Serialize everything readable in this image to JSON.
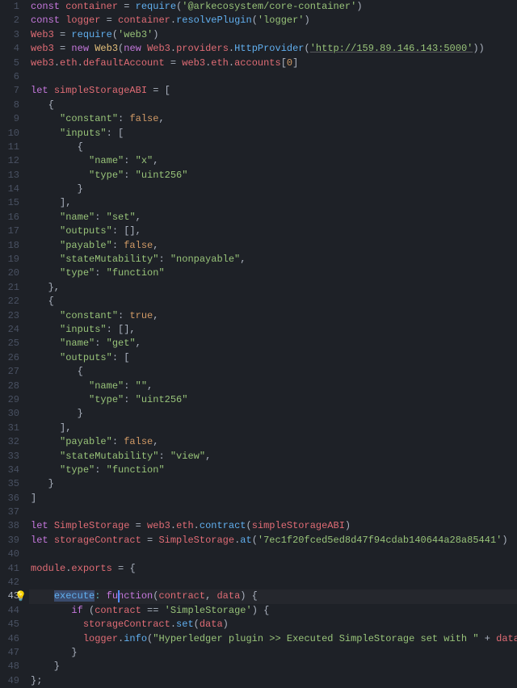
{
  "editor": {
    "current_line": 43,
    "hint_icon": "lightbulb-icon",
    "lines": [
      {
        "n": 1,
        "tokens": [
          [
            "k",
            "const "
          ],
          [
            "v",
            "container"
          ],
          [
            "d",
            " = "
          ],
          [
            "fn",
            "require"
          ],
          [
            "d",
            "("
          ],
          [
            "s",
            "'@arkecosystem/core-container'"
          ],
          [
            "d",
            ")"
          ]
        ]
      },
      {
        "n": 2,
        "tokens": [
          [
            "k",
            "const "
          ],
          [
            "v",
            "logger"
          ],
          [
            "d",
            " = "
          ],
          [
            "v",
            "container"
          ],
          [
            "d",
            "."
          ],
          [
            "fn",
            "resolvePlugin"
          ],
          [
            "d",
            "("
          ],
          [
            "s",
            "'logger'"
          ],
          [
            "d",
            ")"
          ]
        ]
      },
      {
        "n": 3,
        "tokens": [
          [
            "v",
            "Web3"
          ],
          [
            "d",
            " = "
          ],
          [
            "fn",
            "require"
          ],
          [
            "d",
            "("
          ],
          [
            "s",
            "'web3'"
          ],
          [
            "d",
            ")"
          ]
        ]
      },
      {
        "n": 4,
        "tokens": [
          [
            "v",
            "web3"
          ],
          [
            "d",
            " = "
          ],
          [
            "k",
            "new "
          ],
          [
            "p",
            "Web3"
          ],
          [
            "d",
            "("
          ],
          [
            "k",
            "new "
          ],
          [
            "v",
            "Web3"
          ],
          [
            "d",
            "."
          ],
          [
            "v",
            "providers"
          ],
          [
            "d",
            "."
          ],
          [
            "fn",
            "HttpProvider"
          ],
          [
            "d",
            "("
          ],
          [
            "s lnk",
            "'http://159.89.146.143:5000'"
          ],
          [
            "d",
            "))"
          ]
        ]
      },
      {
        "n": 5,
        "tokens": [
          [
            "v",
            "web3"
          ],
          [
            "d",
            "."
          ],
          [
            "v",
            "eth"
          ],
          [
            "d",
            "."
          ],
          [
            "v",
            "defaultAccount"
          ],
          [
            "d",
            " = "
          ],
          [
            "v",
            "web3"
          ],
          [
            "d",
            "."
          ],
          [
            "v",
            "eth"
          ],
          [
            "d",
            "."
          ],
          [
            "v",
            "accounts"
          ],
          [
            "d",
            "["
          ],
          [
            "n",
            "0"
          ],
          [
            "d",
            "]"
          ]
        ]
      },
      {
        "n": 6,
        "tokens": []
      },
      {
        "n": 7,
        "tokens": [
          [
            "k",
            "let "
          ],
          [
            "v",
            "simpleStorageABI"
          ],
          [
            "d",
            " = ["
          ]
        ]
      },
      {
        "n": 8,
        "tokens": [
          [
            "d",
            "   {"
          ]
        ]
      },
      {
        "n": 9,
        "tokens": [
          [
            "d",
            "     "
          ],
          [
            "s",
            "\"constant\""
          ],
          [
            "d",
            ": "
          ],
          [
            "n",
            "false"
          ],
          [
            "d",
            ","
          ]
        ]
      },
      {
        "n": 10,
        "tokens": [
          [
            "d",
            "     "
          ],
          [
            "s",
            "\"inputs\""
          ],
          [
            "d",
            ": ["
          ]
        ]
      },
      {
        "n": 11,
        "tokens": [
          [
            "d",
            "        {"
          ]
        ]
      },
      {
        "n": 12,
        "tokens": [
          [
            "d",
            "          "
          ],
          [
            "s",
            "\"name\""
          ],
          [
            "d",
            ": "
          ],
          [
            "s",
            "\"x\""
          ],
          [
            "d",
            ","
          ]
        ]
      },
      {
        "n": 13,
        "tokens": [
          [
            "d",
            "          "
          ],
          [
            "s",
            "\"type\""
          ],
          [
            "d",
            ": "
          ],
          [
            "s",
            "\"uint256\""
          ]
        ]
      },
      {
        "n": 14,
        "tokens": [
          [
            "d",
            "        }"
          ]
        ]
      },
      {
        "n": 15,
        "tokens": [
          [
            "d",
            "     ],"
          ]
        ]
      },
      {
        "n": 16,
        "tokens": [
          [
            "d",
            "     "
          ],
          [
            "s",
            "\"name\""
          ],
          [
            "d",
            ": "
          ],
          [
            "s",
            "\"set\""
          ],
          [
            "d",
            ","
          ]
        ]
      },
      {
        "n": 17,
        "tokens": [
          [
            "d",
            "     "
          ],
          [
            "s",
            "\"outputs\""
          ],
          [
            "d",
            ": [],"
          ]
        ]
      },
      {
        "n": 18,
        "tokens": [
          [
            "d",
            "     "
          ],
          [
            "s",
            "\"payable\""
          ],
          [
            "d",
            ": "
          ],
          [
            "n",
            "false"
          ],
          [
            "d",
            ","
          ]
        ]
      },
      {
        "n": 19,
        "tokens": [
          [
            "d",
            "     "
          ],
          [
            "s",
            "\"stateMutability\""
          ],
          [
            "d",
            ": "
          ],
          [
            "s",
            "\"nonpayable\""
          ],
          [
            "d",
            ","
          ]
        ]
      },
      {
        "n": 20,
        "tokens": [
          [
            "d",
            "     "
          ],
          [
            "s",
            "\"type\""
          ],
          [
            "d",
            ": "
          ],
          [
            "s",
            "\"function\""
          ]
        ]
      },
      {
        "n": 21,
        "tokens": [
          [
            "d",
            "   },"
          ]
        ]
      },
      {
        "n": 22,
        "tokens": [
          [
            "d",
            "   {"
          ]
        ]
      },
      {
        "n": 23,
        "tokens": [
          [
            "d",
            "     "
          ],
          [
            "s",
            "\"constant\""
          ],
          [
            "d",
            ": "
          ],
          [
            "n",
            "true"
          ],
          [
            "d",
            ","
          ]
        ]
      },
      {
        "n": 24,
        "tokens": [
          [
            "d",
            "     "
          ],
          [
            "s",
            "\"inputs\""
          ],
          [
            "d",
            ": [],"
          ]
        ]
      },
      {
        "n": 25,
        "tokens": [
          [
            "d",
            "     "
          ],
          [
            "s",
            "\"name\""
          ],
          [
            "d",
            ": "
          ],
          [
            "s",
            "\"get\""
          ],
          [
            "d",
            ","
          ]
        ]
      },
      {
        "n": 26,
        "tokens": [
          [
            "d",
            "     "
          ],
          [
            "s",
            "\"outputs\""
          ],
          [
            "d",
            ": ["
          ]
        ]
      },
      {
        "n": 27,
        "tokens": [
          [
            "d",
            "        {"
          ]
        ]
      },
      {
        "n": 28,
        "tokens": [
          [
            "d",
            "          "
          ],
          [
            "s",
            "\"name\""
          ],
          [
            "d",
            ": "
          ],
          [
            "s",
            "\"\""
          ],
          [
            "d",
            ","
          ]
        ]
      },
      {
        "n": 29,
        "tokens": [
          [
            "d",
            "          "
          ],
          [
            "s",
            "\"type\""
          ],
          [
            "d",
            ": "
          ],
          [
            "s",
            "\"uint256\""
          ]
        ]
      },
      {
        "n": 30,
        "tokens": [
          [
            "d",
            "        }"
          ]
        ]
      },
      {
        "n": 31,
        "tokens": [
          [
            "d",
            "     ],"
          ]
        ]
      },
      {
        "n": 32,
        "tokens": [
          [
            "d",
            "     "
          ],
          [
            "s",
            "\"payable\""
          ],
          [
            "d",
            ": "
          ],
          [
            "n",
            "false"
          ],
          [
            "d",
            ","
          ]
        ]
      },
      {
        "n": 33,
        "tokens": [
          [
            "d",
            "     "
          ],
          [
            "s",
            "\"stateMutability\""
          ],
          [
            "d",
            ": "
          ],
          [
            "s",
            "\"view\""
          ],
          [
            "d",
            ","
          ]
        ]
      },
      {
        "n": 34,
        "tokens": [
          [
            "d",
            "     "
          ],
          [
            "s",
            "\"type\""
          ],
          [
            "d",
            ": "
          ],
          [
            "s",
            "\"function\""
          ]
        ]
      },
      {
        "n": 35,
        "tokens": [
          [
            "d",
            "   }"
          ]
        ]
      },
      {
        "n": 36,
        "tokens": [
          [
            "d",
            "]"
          ]
        ]
      },
      {
        "n": 37,
        "tokens": []
      },
      {
        "n": 38,
        "tokens": [
          [
            "k",
            "let "
          ],
          [
            "v",
            "SimpleStorage"
          ],
          [
            "d",
            " = "
          ],
          [
            "v",
            "web3"
          ],
          [
            "d",
            "."
          ],
          [
            "v",
            "eth"
          ],
          [
            "d",
            "."
          ],
          [
            "fn",
            "contract"
          ],
          [
            "d",
            "("
          ],
          [
            "v",
            "simpleStorageABI"
          ],
          [
            "d",
            ")"
          ]
        ]
      },
      {
        "n": 39,
        "tokens": [
          [
            "k",
            "let "
          ],
          [
            "v",
            "storageContract"
          ],
          [
            "d",
            " = "
          ],
          [
            "v",
            "SimpleStorage"
          ],
          [
            "d",
            "."
          ],
          [
            "fn",
            "at"
          ],
          [
            "d",
            "("
          ],
          [
            "s",
            "'7ec1f20fced5ed8d47f94cdab140644a28a85441'"
          ],
          [
            "d",
            ")"
          ]
        ]
      },
      {
        "n": 40,
        "tokens": []
      },
      {
        "n": 41,
        "tokens": [
          [
            "v",
            "module"
          ],
          [
            "d",
            "."
          ],
          [
            "v",
            "exports"
          ],
          [
            "d",
            " = {"
          ]
        ]
      },
      {
        "n": 42,
        "tokens": []
      },
      {
        "n": 43,
        "active": true,
        "bulb": true,
        "tokens": [
          [
            "d",
            "    "
          ],
          [
            "fn sel",
            "execute"
          ],
          [
            "c",
            ":"
          ],
          [
            "d",
            " "
          ],
          [
            "k",
            "function"
          ],
          [
            "d",
            "("
          ],
          [
            "v",
            "contract"
          ],
          [
            "d",
            ", "
          ],
          [
            "v",
            "data"
          ],
          [
            "d",
            ") {"
          ]
        ]
      },
      {
        "n": 44,
        "tokens": [
          [
            "d",
            "       "
          ],
          [
            "k",
            "if"
          ],
          [
            "d",
            " ("
          ],
          [
            "v",
            "contract"
          ],
          [
            "d",
            " == "
          ],
          [
            "s",
            "'SimpleStorage'"
          ],
          [
            "d",
            ") {"
          ]
        ]
      },
      {
        "n": 45,
        "tokens": [
          [
            "d",
            "         "
          ],
          [
            "v",
            "storageContract"
          ],
          [
            "d",
            "."
          ],
          [
            "fn",
            "set"
          ],
          [
            "d",
            "("
          ],
          [
            "v",
            "data"
          ],
          [
            "d",
            ")"
          ]
        ]
      },
      {
        "n": 46,
        "tokens": [
          [
            "d",
            "         "
          ],
          [
            "v",
            "logger"
          ],
          [
            "d",
            "."
          ],
          [
            "fn",
            "info"
          ],
          [
            "d",
            "("
          ],
          [
            "s",
            "\"Hyperledger plugin >> Executed SimpleStorage set with \""
          ],
          [
            "d",
            " + "
          ],
          [
            "v",
            "data"
          ],
          [
            "d",
            ");"
          ]
        ]
      },
      {
        "n": 47,
        "tokens": [
          [
            "d",
            "       }"
          ]
        ]
      },
      {
        "n": 48,
        "tokens": [
          [
            "d",
            "    }"
          ]
        ]
      },
      {
        "n": 49,
        "tokens": [
          [
            "d",
            "};"
          ]
        ]
      }
    ]
  }
}
